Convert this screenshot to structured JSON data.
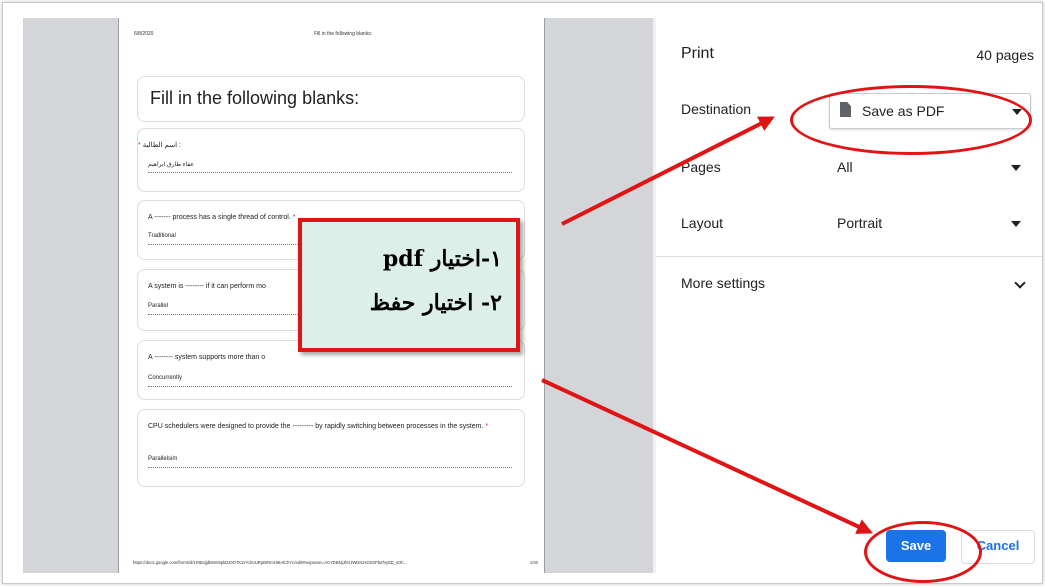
{
  "preview": {
    "date": "6/8/2020",
    "header_title": "Fill in the following blanks:",
    "form_title": "Fill in the following blanks:",
    "questions": [
      {
        "text": "اسم الطالبة :",
        "required": "*",
        "answer": "عفاء طارق ابراهيم"
      },
      {
        "text": "A ------- process has a single thread of control.",
        "required": "*",
        "answer": "Traditional"
      },
      {
        "text": "A system is -------- if it can perform mo",
        "required": "",
        "answer": "Parallel"
      },
      {
        "text": "A -------- system supports more than o",
        "required": "",
        "answer": "Concurrently"
      },
      {
        "text": "CPU schedulers were designed to provide the --------- by rapidly switching between processes in the system.",
        "required": "*",
        "answer": "Parallelsim"
      }
    ],
    "footer_url": "https://docs.google.com/forms/d/1RIBvjjdbMm9pkDz0OTK2vYdAIURpBrRmHI6AlChYc/edit#response=ACYDBNjJhGJWDNzsO2SPbZlVy5D_sOh...",
    "page_number": "1/40"
  },
  "panel": {
    "title": "Print",
    "page_count": "40 pages",
    "destination_label": "Destination",
    "destination_value": "Save as PDF",
    "pages_label": "Pages",
    "pages_value": "All",
    "layout_label": "Layout",
    "layout_value": "Portrait",
    "more_settings_label": "More settings",
    "save_label": "Save",
    "cancel_label": "Cancel"
  },
  "annotation": {
    "line1": "١-اختيار pdf",
    "line2": "٢- اختيار حفظ"
  },
  "colors": {
    "accent": "#1a73e8",
    "annotation_red": "#e01414",
    "callout_bg": "#dcefe8"
  }
}
